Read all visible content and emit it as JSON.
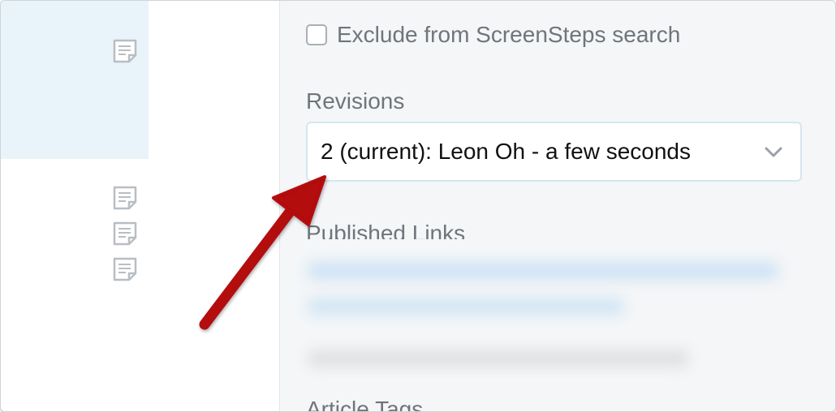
{
  "checkbox": {
    "label": "Exclude from ScreenSteps search",
    "checked": false
  },
  "revisions": {
    "label": "Revisions",
    "selected": "2 (current): Leon Oh - a few seconds"
  },
  "published_links": {
    "label": "Published Links"
  },
  "article_tags": {
    "label": "Article Tags"
  },
  "icons": {
    "doc": "document-icon",
    "chevron": "chevron-down-icon"
  },
  "colors": {
    "selection_bg": "#e8f4f9",
    "panel_bg": "#f4f6f8",
    "annotation_arrow": "#b3070b"
  }
}
